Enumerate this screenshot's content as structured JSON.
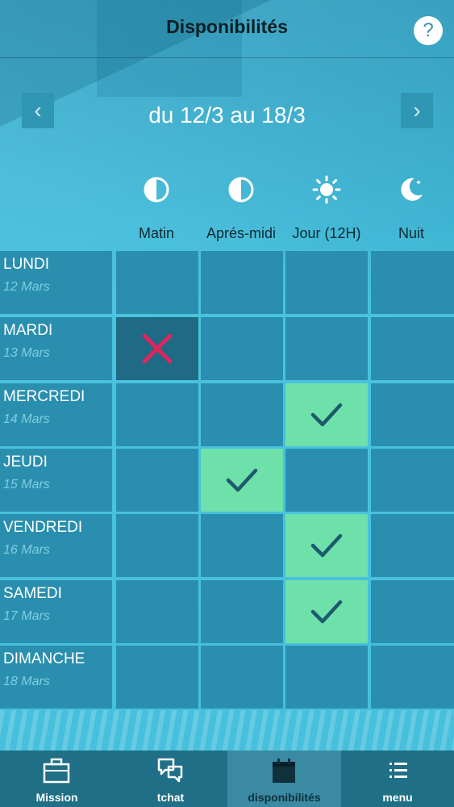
{
  "header": {
    "title": "Disponibilités",
    "help_label": "?"
  },
  "week": {
    "label": "du 12/3 au 18/3",
    "prev_label": "‹",
    "next_label": "›"
  },
  "columns": [
    {
      "label": "Matin",
      "icon": "half-circle-icon"
    },
    {
      "label": "Aprés-midi",
      "icon": "half-circle-icon"
    },
    {
      "label": "Jour (12H)",
      "icon": "sun-icon"
    },
    {
      "label": "Nuit",
      "icon": "moon-icon"
    }
  ],
  "days": [
    {
      "name": "LUNDI",
      "date": "12 Mars",
      "slots": [
        "none",
        "none",
        "none",
        "none"
      ]
    },
    {
      "name": "MARDI",
      "date": "13 Mars",
      "slots": [
        "unavailable",
        "none",
        "none",
        "none"
      ]
    },
    {
      "name": "MERCREDI",
      "date": "14 Mars",
      "slots": [
        "none",
        "none",
        "available",
        "none"
      ]
    },
    {
      "name": "JEUDI",
      "date": "15 Mars",
      "slots": [
        "none",
        "available",
        "none",
        "none"
      ]
    },
    {
      "name": "VENDREDI",
      "date": "16 Mars",
      "slots": [
        "none",
        "none",
        "available",
        "none"
      ]
    },
    {
      "name": "SAMEDI",
      "date": "17 Mars",
      "slots": [
        "none",
        "none",
        "available",
        "none"
      ]
    },
    {
      "name": "DIMANCHE",
      "date": "18 Mars",
      "slots": [
        "none",
        "none",
        "none",
        "none"
      ]
    }
  ],
  "tabs": [
    {
      "label": "Mission",
      "icon": "briefcase-icon",
      "active": false
    },
    {
      "label": "tchat",
      "icon": "chat-icon",
      "active": false
    },
    {
      "label": "disponibilités",
      "icon": "calendar-icon",
      "active": true
    },
    {
      "label": "menu",
      "icon": "list-icon",
      "active": false
    }
  ],
  "colors": {
    "available": "#6ee0a9",
    "unavailable": "#1f6a84",
    "cross": "#e0245e",
    "check": "#1d5a6e"
  }
}
